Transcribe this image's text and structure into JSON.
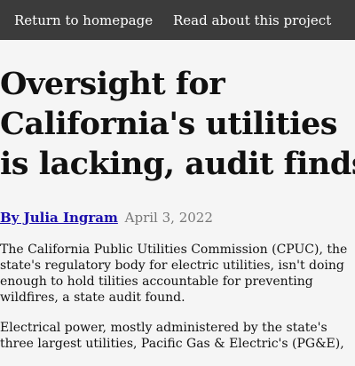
{
  "nav": {
    "home_label": "Return to homepage",
    "project_label": "Read about this project"
  },
  "article": {
    "headline_lines": [
      "Oversight for",
      "California's utilities",
      "is lacking, audit finds"
    ],
    "byline_author": "By Julia Ingram",
    "date": "April 3, 2022",
    "paragraph1_lines": [
      "The California Public Utilities Commission (CPUC), the",
      "state's regulatory body for electric utilities, isn't doing",
      "enough to hold tilities accountable for preventing",
      "wildfires, a state audit found."
    ],
    "paragraph2_lines": [
      "Electrical power, mostly administered by the state's",
      "three largest utilities, Pacific Gas & Electric's (PG&E),"
    ]
  },
  "colors": {
    "nav_background": "#3b3b3b",
    "link": "#1a0dab",
    "date": "#777777",
    "page_background": "#f5f5f5"
  }
}
